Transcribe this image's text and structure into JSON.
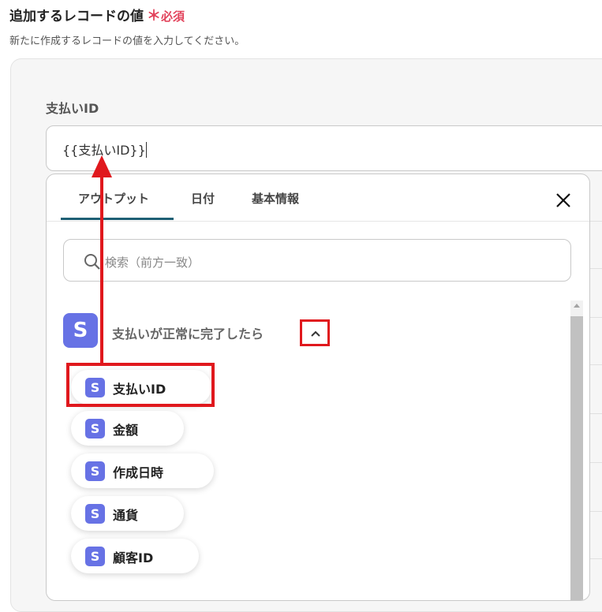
{
  "header": {
    "title": "追加するレコードの値",
    "required_star": "＊",
    "required_label": "必須",
    "subtitle": "新たに作成するレコードの値を入力してください。"
  },
  "field": {
    "label": "支払いID",
    "value": "{{支払いID}}"
  },
  "picker": {
    "tabs": [
      {
        "label": "アウトプット",
        "active": true
      },
      {
        "label": "日付",
        "active": false
      },
      {
        "label": "基本情報",
        "active": false
      }
    ],
    "search_placeholder": "検索（前方一致）",
    "group": {
      "icon_letter": "S",
      "label": "支払いが正常に完了したら",
      "expanded": true
    },
    "items": [
      {
        "icon_letter": "S",
        "label": "支払いID",
        "highlighted": true
      },
      {
        "icon_letter": "S",
        "label": "金額"
      },
      {
        "icon_letter": "S",
        "label": "作成日時"
      },
      {
        "icon_letter": "S",
        "label": "通貨"
      },
      {
        "icon_letter": "S",
        "label": "顧客ID"
      }
    ]
  },
  "colors": {
    "accent_tab": "#1e5f74",
    "stripe_brand": "#6772e5",
    "required": "#e2445c",
    "annotation_red": "#e0181d"
  }
}
